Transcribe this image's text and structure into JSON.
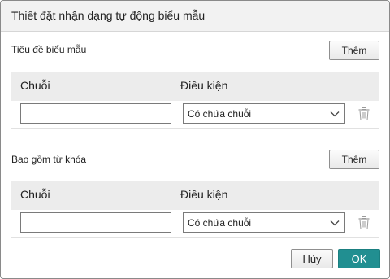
{
  "dialog": {
    "title": "Thiết đặt nhận dạng tự động biểu mẫu"
  },
  "sections": [
    {
      "label": "Tiêu đề biểu mẫu",
      "add_label": "Thêm",
      "col_string": "Chuỗi",
      "col_condition": "Điều kiện",
      "row": {
        "string_value": "",
        "condition_value": "Có chứa chuỗi"
      }
    },
    {
      "label": "Bao gồm từ khóa",
      "add_label": "Thêm",
      "col_string": "Chuỗi",
      "col_condition": "Điều kiện",
      "row": {
        "string_value": "",
        "condition_value": "Có chứa chuỗi"
      }
    }
  ],
  "footer": {
    "cancel_label": "Hủy",
    "ok_label": "OK"
  },
  "colors": {
    "accent": "#218f91",
    "header_bg": "#ececec",
    "titlebar_bg": "#f2f2f2"
  },
  "icons": {
    "dropdown": "chevron-down-icon",
    "delete": "trash-icon"
  }
}
